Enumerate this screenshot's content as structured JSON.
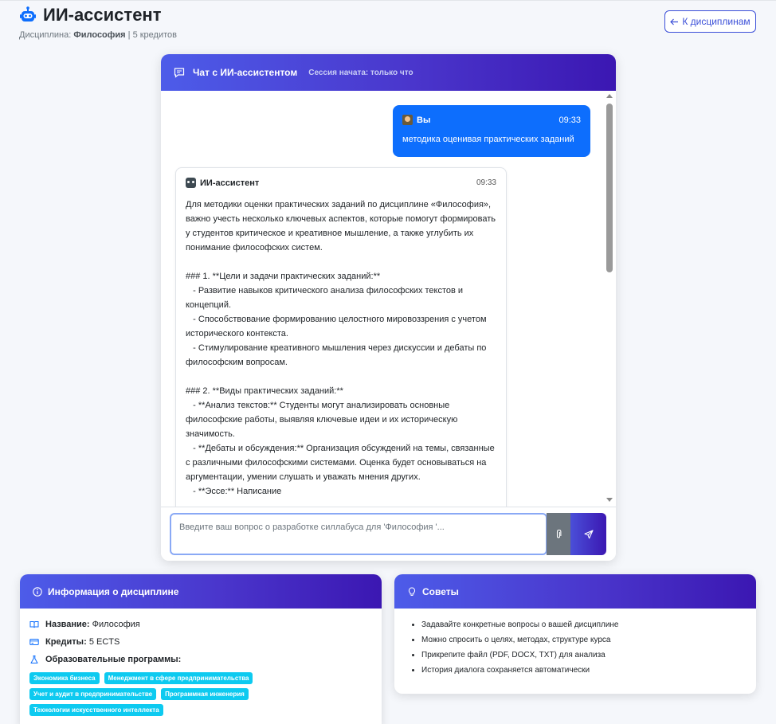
{
  "header": {
    "title": "ИИ-ассистент",
    "sub_label": "Дисциплина:",
    "discipline": "Философия",
    "credits": "| 5 кредитов",
    "back_button": "К дисциплинам"
  },
  "chat": {
    "title": "Чат с ИИ-ассистентом",
    "session": "Сессия начата: только что",
    "user_message": {
      "author": "Вы",
      "time": "09:33",
      "text": "методика оценивая практических заданий"
    },
    "ai_message": {
      "author": "ИИ-ассистент",
      "time": "09:33",
      "lines": [
        "Для методики оценки практических заданий по дисциплине «Философия», важно учесть несколько ключевых аспектов, которые помогут формировать у студентов критическое и креативное мышление, а также углубить их понимание философских систем.",
        "",
        "### 1. **Цели и задачи практических заданий:**",
        "   - Развитие навыков критического анализа философских текстов и концепций.",
        "   - Способствование формированию целостного мировоззрения с учетом исторического контекста.",
        "   - Стимулирование креативного мышления через дискуссии и дебаты по философским вопросам.",
        "",
        "### 2. **Виды практических заданий:**",
        "   - **Анализ текстов:** Студенты могут анализировать основные философские работы, выявляя ключевые идеи и их историческую значимость.",
        "   - **Дебаты и обсуждения:** Организация обсуждений на темы, связанные с различными философскими системами. Оценка будет основываться на аргументации, умении слушать и уважать мнения других.",
        "   - **Эссе:** Написание"
      ]
    },
    "input_placeholder": "Введите ваш вопрос о разработке силлабуса для 'Философия '..."
  },
  "info": {
    "title": "Информация о дисциплине",
    "name_label": "Название:",
    "name_value": "Философия",
    "credits_label": "Кредиты:",
    "credits_value": "5 ECTS",
    "programs_label": "Образовательные программы:",
    "programs": [
      "Экономика бизнеса",
      "Менеджмент в сфере предпринимательства",
      "Учет и аудит в предпринимательстве",
      "Программная инженерия",
      "Технологии искусственного интеллекта"
    ]
  },
  "tips": {
    "title": "Советы",
    "items": [
      "Задавайте конкретные вопросы о вашей дисциплине",
      "Можно спросить о целях, методах, структуре курса",
      "Прикрепите файл (PDF, DOCX, TXT) для анализа",
      "История диалога сохраняется автоматически"
    ]
  },
  "colors": {
    "accent": "#4a36cc",
    "user_bubble": "#0d6efd",
    "tag": "#0dcaf0"
  }
}
